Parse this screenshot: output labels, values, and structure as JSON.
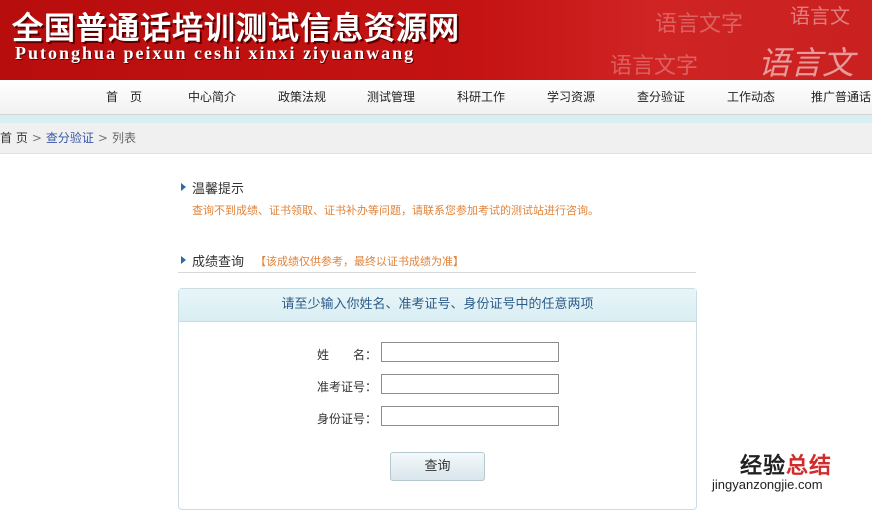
{
  "banner": {
    "title": "全国普通话培训测试信息资源网",
    "pinyin": "Putonghua peixun ceshi xinxi ziyuanwang",
    "deco_1": "语言文字",
    "deco_2": "语言文",
    "deco_3": "语言文字",
    "deco_4": "语言文"
  },
  "nav": {
    "items": [
      "首　页",
      "中心简介",
      "政策法规",
      "测试管理",
      "科研工作",
      "学习资源",
      "查分验证",
      "工作动态",
      "推广普通话"
    ]
  },
  "breadcrumb": {
    "home": "首 页",
    "sep": ">",
    "section": "查分验证",
    "current": "列表"
  },
  "notice": {
    "heading": "温馨提示",
    "text": "查询不到成绩、证书领取、证书补办等问题，请联系您参加考试的测试站进行咨询。"
  },
  "score": {
    "heading": "成绩查询",
    "note": "【该成绩仅供参考，最终以证书成绩为准】"
  },
  "form": {
    "instruction": "请至少输入你姓名、准考证号、身份证号中的任意两项",
    "name_label": "姓　　名：",
    "exam_no_label": "准考证号：",
    "id_no_label": "身份证号：",
    "name_value": "",
    "exam_no_value": "",
    "id_no_value": "",
    "submit_label": "查询"
  },
  "watermark": {
    "part1": "经验",
    "part2": "总结",
    "sub": "jingyanzongjie.com"
  },
  "colors": {
    "banner_red": "#c51313",
    "notice_orange": "#e0833a",
    "header_blue": "#2d5c8a"
  }
}
